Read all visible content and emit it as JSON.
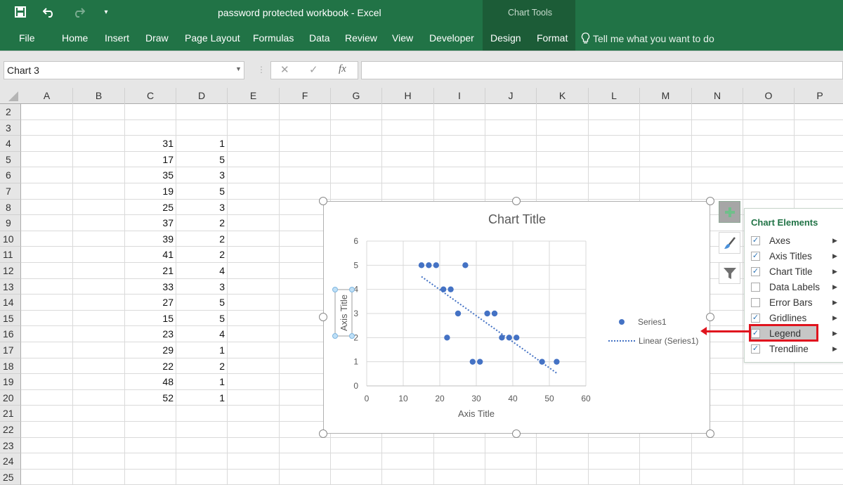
{
  "window": {
    "title": "password protected workbook  -  Excel",
    "context_group": "Chart Tools"
  },
  "qat": {
    "save_icon": "save-icon",
    "undo_icon": "undo-icon",
    "redo_icon": "redo-icon",
    "customize_icon": "customize-qat-icon"
  },
  "ribbon": {
    "tabs": [
      "File",
      "Home",
      "Insert",
      "Draw",
      "Page Layout",
      "Formulas",
      "Data",
      "Review",
      "View",
      "Developer",
      "Design",
      "Format"
    ],
    "tell_me": "Tell me what you want to do"
  },
  "formula_bar": {
    "name_box": "Chart 3",
    "cancel": "✕",
    "enter": "✓",
    "fx": "fx",
    "formula": ""
  },
  "sheet": {
    "columns": [
      "A",
      "B",
      "C",
      "D",
      "E",
      "F",
      "G",
      "H",
      "I",
      "J",
      "K",
      "L",
      "M",
      "N",
      "O",
      "P"
    ],
    "rows": [
      "2",
      "3",
      "4",
      "5",
      "6",
      "7",
      "8",
      "9",
      "10",
      "11",
      "12",
      "13",
      "14",
      "15",
      "16",
      "17",
      "18",
      "19",
      "20",
      "21",
      "22",
      "23",
      "24",
      "25"
    ],
    "data": [
      {
        "row": "4",
        "C": "31",
        "D": "1"
      },
      {
        "row": "5",
        "C": "17",
        "D": "5"
      },
      {
        "row": "6",
        "C": "35",
        "D": "3"
      },
      {
        "row": "7",
        "C": "19",
        "D": "5"
      },
      {
        "row": "8",
        "C": "25",
        "D": "3"
      },
      {
        "row": "9",
        "C": "37",
        "D": "2"
      },
      {
        "row": "10",
        "C": "39",
        "D": "2"
      },
      {
        "row": "11",
        "C": "41",
        "D": "2"
      },
      {
        "row": "12",
        "C": "21",
        "D": "4"
      },
      {
        "row": "13",
        "C": "33",
        "D": "3"
      },
      {
        "row": "14",
        "C": "27",
        "D": "5"
      },
      {
        "row": "15",
        "C": "15",
        "D": "5"
      },
      {
        "row": "16",
        "C": "23",
        "D": "4"
      },
      {
        "row": "17",
        "C": "29",
        "D": "1"
      },
      {
        "row": "18",
        "C": "22",
        "D": "2"
      },
      {
        "row": "19",
        "C": "48",
        "D": "1"
      },
      {
        "row": "20",
        "C": "52",
        "D": "1"
      }
    ]
  },
  "chart_data": {
    "type": "scatter",
    "title": "Chart Title",
    "xlabel": "Axis Title",
    "ylabel": "Axis Title",
    "xlim": [
      0,
      60
    ],
    "ylim": [
      0,
      6
    ],
    "xticks": [
      "0",
      "10",
      "20",
      "30",
      "40",
      "50",
      "60"
    ],
    "yticks": [
      "0",
      "1",
      "2",
      "3",
      "4",
      "5",
      "6"
    ],
    "grid": true,
    "legend_position": "right",
    "series": [
      {
        "name": "Series1",
        "color": "#4472c4",
        "x": [
          31,
          17,
          35,
          19,
          25,
          37,
          39,
          41,
          21,
          33,
          27,
          15,
          23,
          29,
          22,
          48,
          52
        ],
        "y": [
          1,
          5,
          3,
          5,
          3,
          2,
          2,
          2,
          4,
          3,
          5,
          5,
          4,
          1,
          2,
          1,
          1
        ]
      }
    ],
    "trendline": {
      "name": "Linear (Series1)",
      "type": "linear",
      "style": "dotted",
      "color": "#4472c4",
      "x_range": [
        15,
        52
      ]
    }
  },
  "side_buttons": {
    "elements": "chart-elements-plus-icon",
    "styles": "chart-styles-brush-icon",
    "filters": "chart-filters-funnel-icon"
  },
  "chart_elements_panel": {
    "title": "Chart Elements",
    "items": [
      {
        "label": "Axes",
        "checked": true
      },
      {
        "label": "Axis Titles",
        "checked": true
      },
      {
        "label": "Chart Title",
        "checked": true
      },
      {
        "label": "Data Labels",
        "checked": false
      },
      {
        "label": "Error Bars",
        "checked": false
      },
      {
        "label": "Gridlines",
        "checked": true
      },
      {
        "label": "Legend",
        "checked": true
      },
      {
        "label": "Trendline",
        "checked": true
      }
    ]
  },
  "annotation": {
    "highlight": "Legend",
    "accent_color": "#e0141e"
  },
  "colors": {
    "excel_green": "#217346",
    "chart_tools_dark": "#1c5c37",
    "series_blue": "#4472c4"
  }
}
